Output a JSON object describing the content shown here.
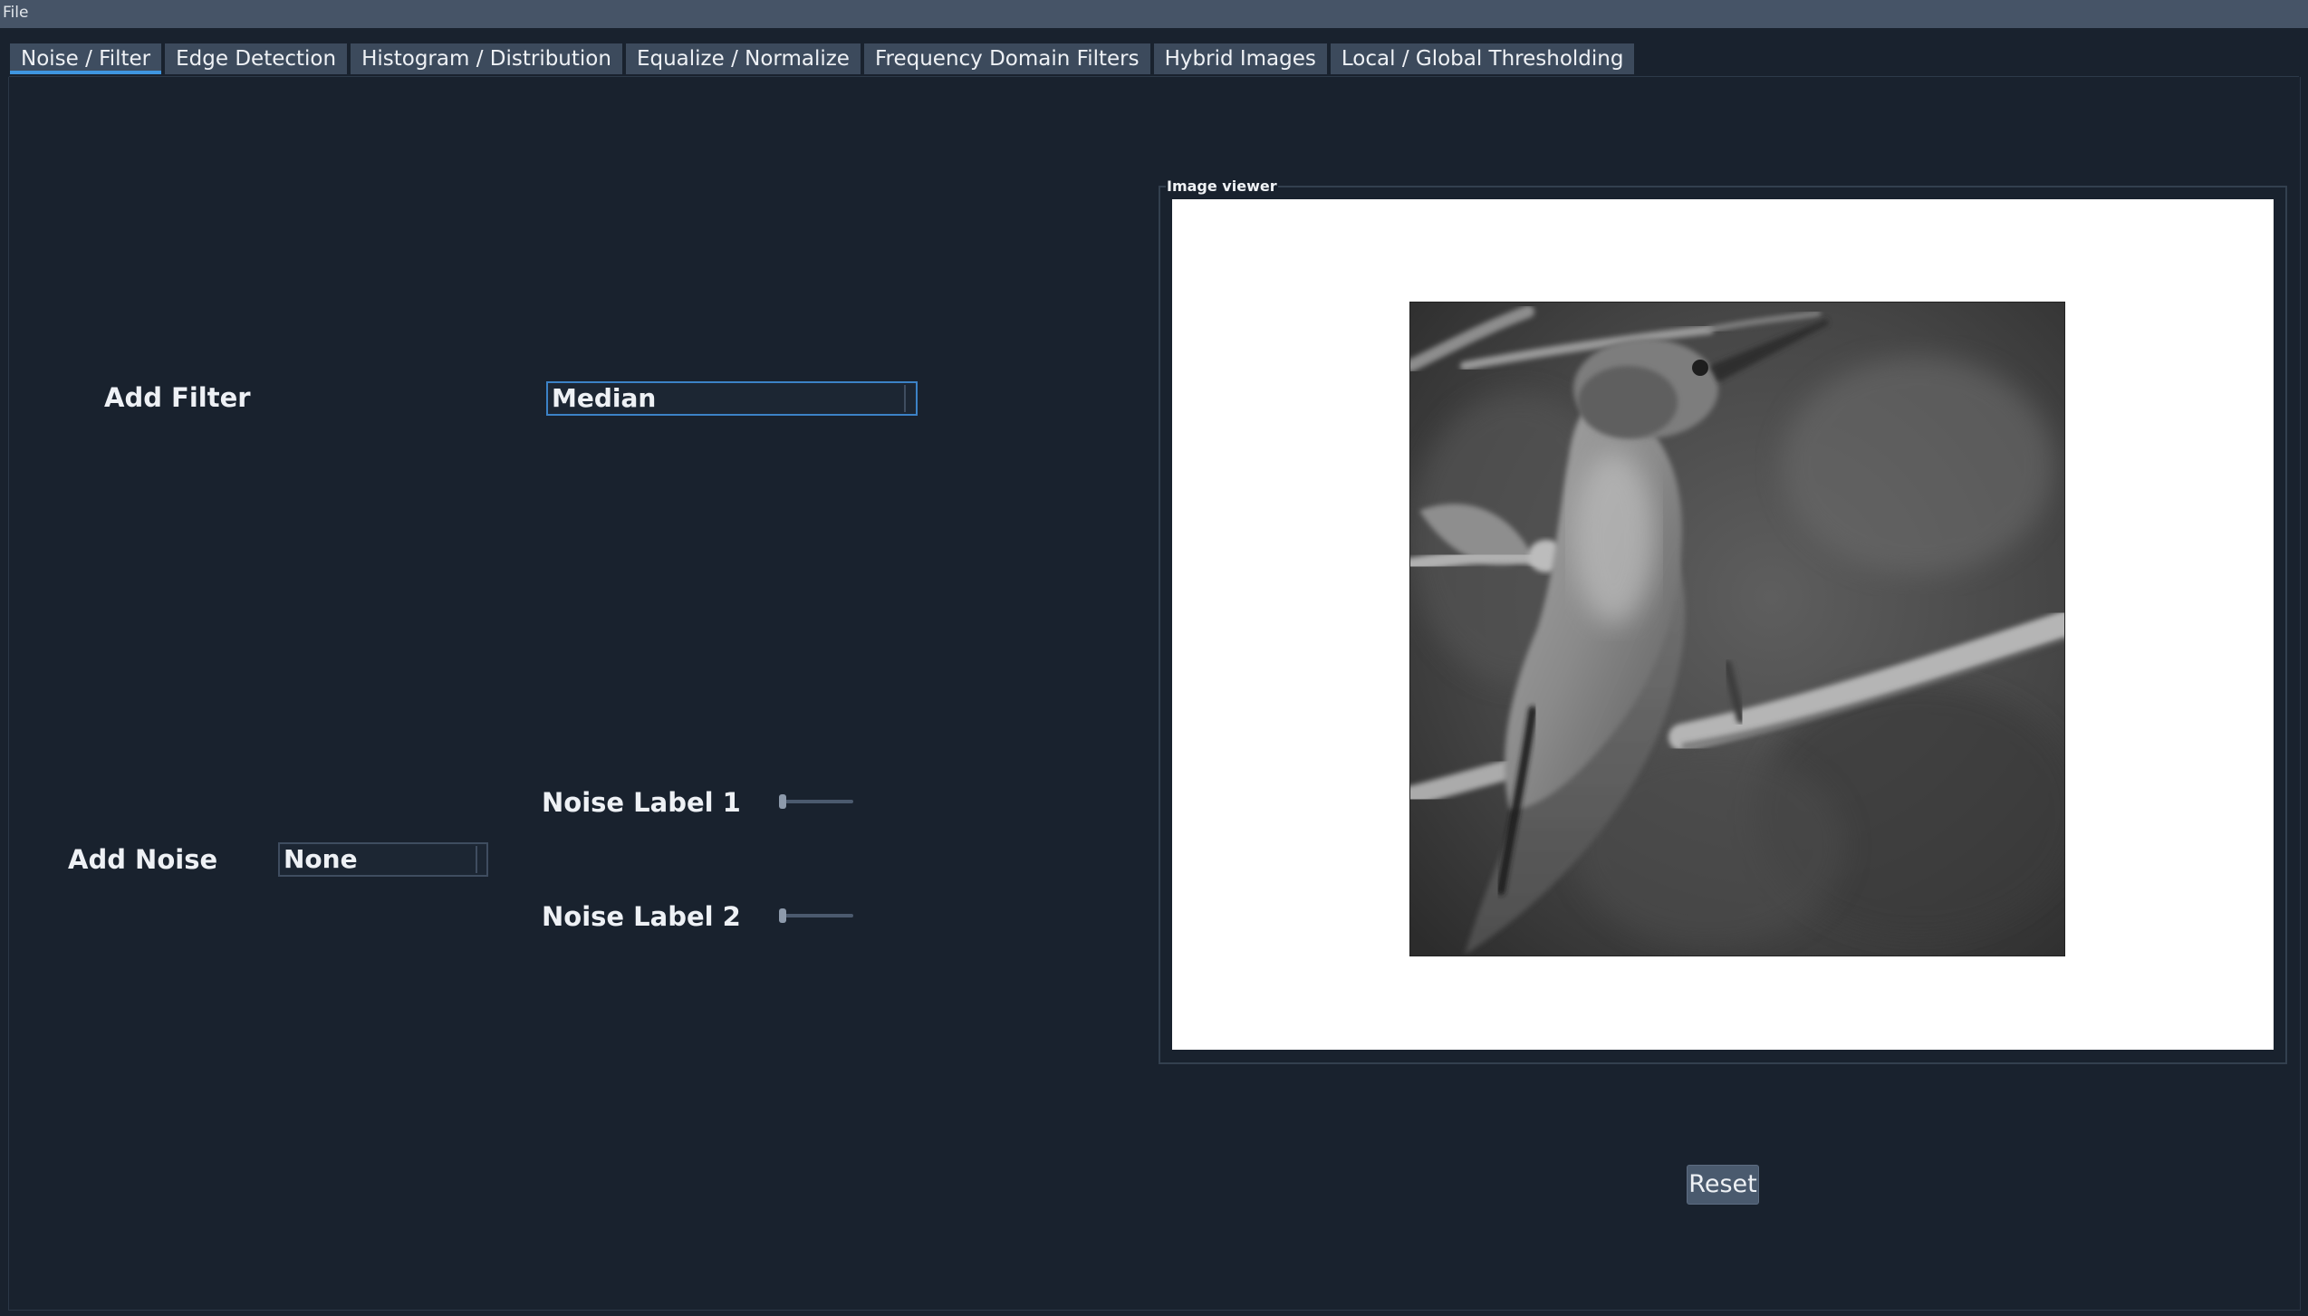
{
  "menubar": {
    "file_label": "File"
  },
  "tabs": [
    {
      "label": "Noise / Filter",
      "active": true
    },
    {
      "label": "Edge Detection",
      "active": false
    },
    {
      "label": "Histogram / Distribution",
      "active": false
    },
    {
      "label": "Equalize / Normalize",
      "active": false
    },
    {
      "label": "Frequency Domain Filters",
      "active": false
    },
    {
      "label": "Hybrid Images",
      "active": false
    },
    {
      "label": "Local / Global Thresholding",
      "active": false
    }
  ],
  "filter": {
    "label": "Add Filter",
    "selected": "Median"
  },
  "noise": {
    "label": "Add Noise",
    "selected": "None",
    "slider1_label": "Noise Label 1",
    "slider1_value": 0,
    "slider2_label": "Noise Label 2",
    "slider2_value": 0
  },
  "viewer": {
    "title": "Image viewer",
    "image_subject": "grayscale-hummingbird-on-branch"
  },
  "actions": {
    "reset_label": "Reset"
  },
  "colors": {
    "background": "#19222e",
    "menubar": "#465467",
    "tab": "#3c4a5c",
    "accent": "#3f96e0",
    "button": "#4a5a6e"
  }
}
